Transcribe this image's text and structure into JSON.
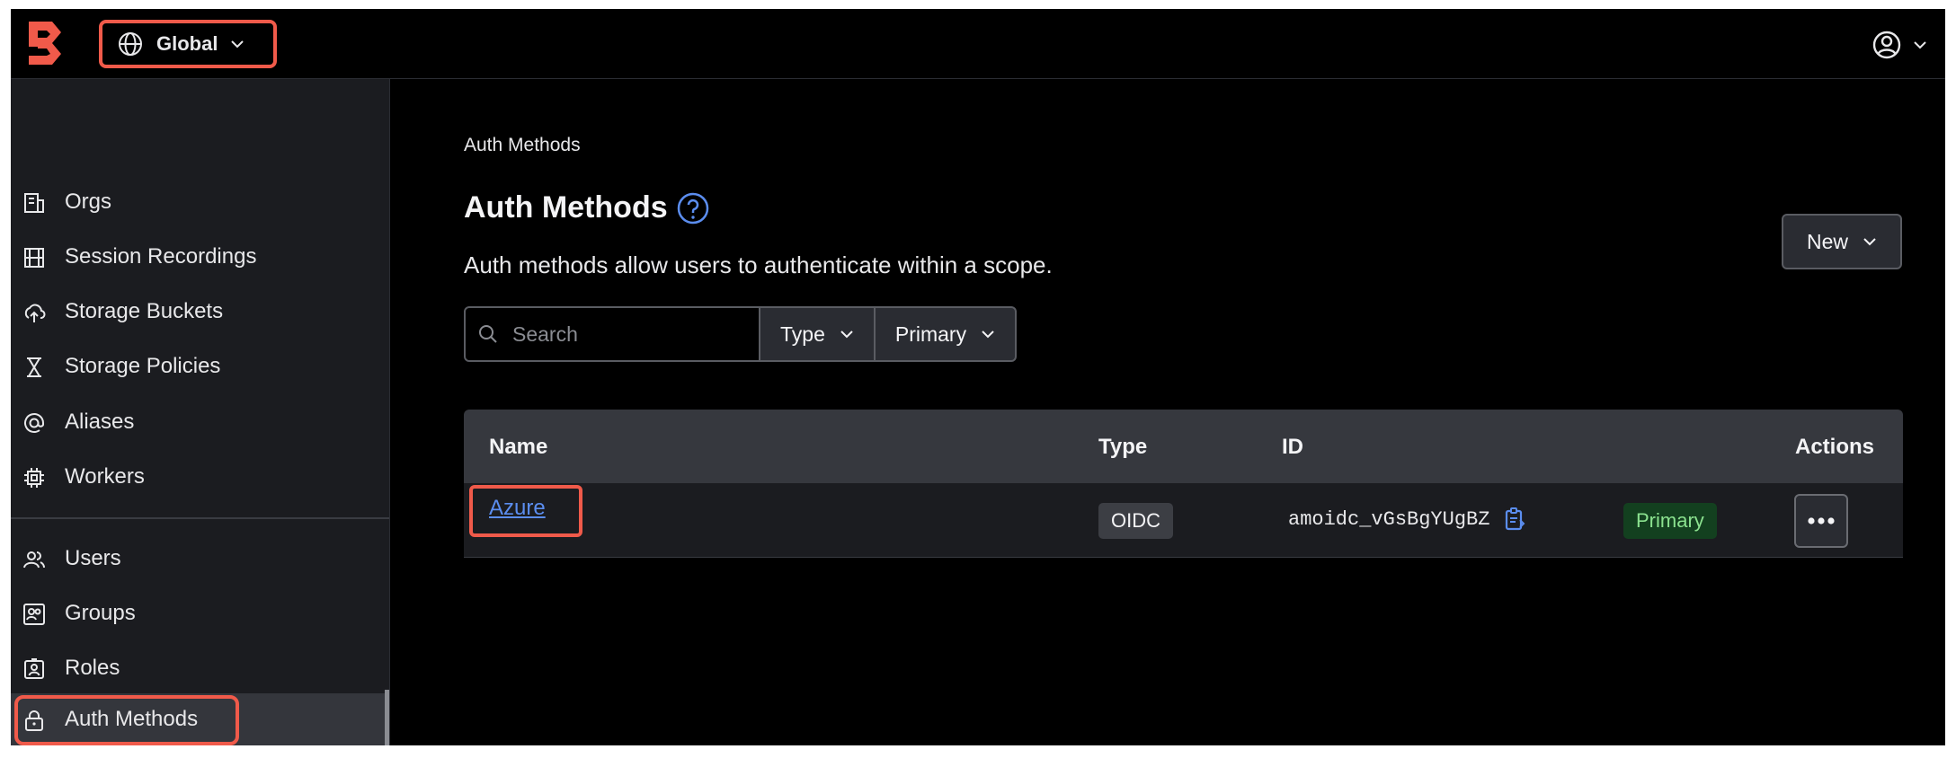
{
  "topbar": {
    "logo_icon": "boundary-logo-icon",
    "scope_label": "Global",
    "scope_icon": "globe-icon",
    "user_icon": "user-circle-icon"
  },
  "sidebar": {
    "items": [
      {
        "label": "Orgs",
        "icon": "building-icon"
      },
      {
        "label": "Session Recordings",
        "icon": "film-icon"
      },
      {
        "label": "Storage Buckets",
        "icon": "cloud-upload-icon"
      },
      {
        "label": "Storage Policies",
        "icon": "hourglass-icon"
      },
      {
        "label": "Aliases",
        "icon": "at-sign-icon"
      },
      {
        "label": "Workers",
        "icon": "cpu-icon"
      },
      {
        "label": "Users",
        "icon": "users-icon"
      },
      {
        "label": "Groups",
        "icon": "group-icon"
      },
      {
        "label": "Roles",
        "icon": "id-card-icon"
      },
      {
        "label": "Auth Methods",
        "icon": "lock-icon",
        "active": true
      }
    ]
  },
  "main": {
    "breadcrumb": "Auth Methods",
    "title": "Auth Methods",
    "description": "Auth methods allow users to authenticate within a scope.",
    "new_button": "New",
    "search_placeholder": "Search",
    "filters": [
      "Type",
      "Primary"
    ],
    "table": {
      "headers": [
        "Name",
        "Type",
        "ID",
        "Actions"
      ],
      "rows": [
        {
          "name": "Azure",
          "type": "OIDC",
          "id": "amoidc_vGsBgYUgBZ",
          "badge": "Primary"
        }
      ]
    }
  },
  "colors": {
    "highlight": "#f05a4a",
    "link": "#5b8def",
    "primary_badge_bg": "#13401f",
    "primary_badge_text": "#8be28f",
    "sidebar_bg": "#1b1c20"
  }
}
